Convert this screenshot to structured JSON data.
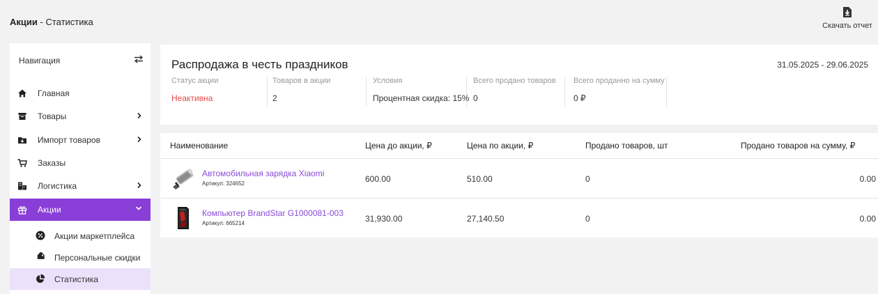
{
  "header": {
    "section": "Акции",
    "separator": " - ",
    "page": "Статистика",
    "download_label": "Скачать отчет"
  },
  "sidebar": {
    "title": "Навигация",
    "items": [
      {
        "label": "Главная",
        "icon": "home-icon"
      },
      {
        "label": "Товары",
        "icon": "archive-box-icon"
      },
      {
        "label": "Импорт товаров",
        "icon": "folder-download-icon"
      },
      {
        "label": "Заказы",
        "icon": "cart-icon"
      },
      {
        "label": "Логистика",
        "icon": "warehouse-icon"
      },
      {
        "label": "Акции",
        "icon": "gift-icon"
      }
    ],
    "subitems": [
      {
        "label": "Акции маркетплейса",
        "icon": "percent-icon"
      },
      {
        "label": "Персональные скидки",
        "icon": "tags-icon"
      },
      {
        "label": "Статистика",
        "icon": "pie-chart-icon"
      }
    ]
  },
  "promo": {
    "title": "Распродажа в честь праздников",
    "date_range": "31.05.2025 - 29.06.2025",
    "stats": [
      {
        "label": "Статус акции",
        "value": "Неактивна"
      },
      {
        "label": "Товаров в акции",
        "value": "2"
      },
      {
        "label": "Условия",
        "value": "Процентная скидка: 15%"
      },
      {
        "label": "Всего продано товаров",
        "value": "0"
      },
      {
        "label": "Всего проданно на сумму",
        "value": "0 ₽"
      }
    ],
    "status_color": "#e44848"
  },
  "table": {
    "headers": [
      "Наименование",
      "Цена до акции, ₽",
      "Цена по акции, ₽",
      "Продано товаров, шт",
      "Продано товаров на сумму, ₽"
    ],
    "rows": [
      {
        "name": "Автомобильная зарядка Xiaomi",
        "sku": "Артикул: 324652",
        "price_before": "600.00",
        "price_promo": "510.00",
        "sold_qty": "0",
        "sold_sum": "0.00",
        "image": "car-charger-image"
      },
      {
        "name": "Компьютер BrandStar G1000081-003",
        "sku": "Артикул: 665214",
        "price_before": "31,930.00",
        "price_promo": "27,140.50",
        "sold_qty": "0",
        "sold_sum": "0.00",
        "image": "pc-tower-image"
      }
    ]
  },
  "colors": {
    "accent": "#8a3ed8",
    "link": "#8a4ad8",
    "active_sub_bg": "#ece1fb"
  }
}
